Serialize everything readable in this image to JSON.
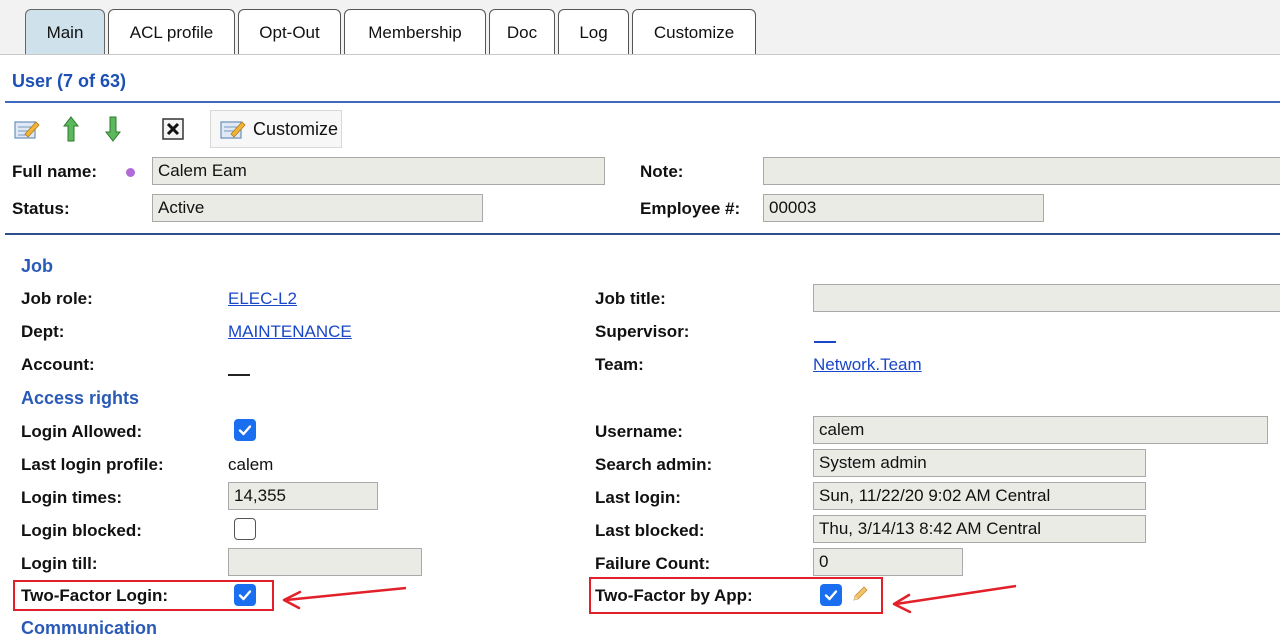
{
  "tabs": [
    {
      "label": "Main",
      "active": true
    },
    {
      "label": "ACL profile",
      "active": false
    },
    {
      "label": "Opt-Out",
      "active": false
    },
    {
      "label": "Membership",
      "active": false
    },
    {
      "label": "Doc",
      "active": false
    },
    {
      "label": "Log",
      "active": false
    },
    {
      "label": "Customize",
      "active": false
    }
  ],
  "header": {
    "title": "User (7 of 63)"
  },
  "toolbar": {
    "icons": [
      "edit-icon",
      "arrow-up-icon",
      "arrow-down-icon",
      "close-icon"
    ],
    "customize_label": "Customize"
  },
  "summary": {
    "full_name_label": "Full name:",
    "full_name_value": "Calem Eam",
    "note_label": "Note:",
    "note_value": "",
    "status_label": "Status:",
    "status_value": "Active",
    "employee_label": "Employee #:",
    "employee_value": "00003"
  },
  "job": {
    "section": "Job",
    "job_role_label": "Job role:",
    "job_role_value": "ELEC-L2",
    "job_title_label": "Job title:",
    "job_title_value": "",
    "dept_label": "Dept:",
    "dept_value": "MAINTENANCE",
    "supervisor_label": "Supervisor:",
    "account_label": "Account:",
    "team_label": "Team:",
    "team_value": "Network.Team"
  },
  "access": {
    "section": "Access rights",
    "login_allowed_label": "Login Allowed:",
    "login_allowed": true,
    "username_label": "Username:",
    "username_value": "calem",
    "last_login_profile_label": "Last login profile:",
    "last_login_profile_value": "calem",
    "search_admin_label": "Search admin:",
    "search_admin_value": "System admin",
    "login_times_label": "Login times:",
    "login_times_value": "14,355",
    "last_login_label": "Last login:",
    "last_login_value": "Sun, 11/22/20 9:02 AM Central",
    "login_blocked_label": "Login blocked:",
    "login_blocked": false,
    "last_blocked_label": "Last blocked:",
    "last_blocked_value": "Thu, 3/14/13 8:42 AM Central",
    "login_till_label": "Login till:",
    "login_till_value": "",
    "failure_count_label": "Failure Count:",
    "failure_count_value": "0",
    "two_factor_login_label": "Two-Factor Login:",
    "two_factor_login": true,
    "two_factor_app_label": "Two-Factor by App:",
    "two_factor_app": true
  },
  "communication": {
    "section": "Communication"
  },
  "colors": {
    "link": "#1a46c9",
    "section": "#2a5ab8",
    "highlight": "#e2202a",
    "checkbox": "#1a6ef0",
    "active_tab": "#cfe1ea"
  }
}
